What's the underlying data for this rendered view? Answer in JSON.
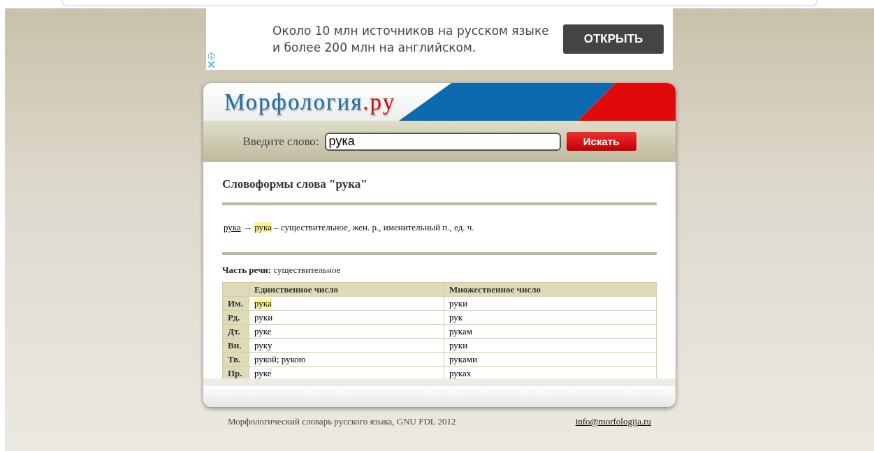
{
  "ad": {
    "text": "Около 10 млн источников на русском языке и более 200 млн на английском.",
    "button": "ОТКРЫТЬ"
  },
  "logo": {
    "name": "Морфология",
    "suffix": ".ру"
  },
  "search": {
    "label": "Введите слово:",
    "value": "рука",
    "button": "Искать"
  },
  "heading": "Словоформы слова \"рука\"",
  "wordform": {
    "source": "рука",
    "arrow": "→",
    "form": "рука",
    "highlighted": true,
    "description": "– существительное, жен. р., именительный п., ед. ч."
  },
  "part_of_speech": {
    "label": "Часть речи:",
    "value": "существительное"
  },
  "table": {
    "columns": [
      "Единственное число",
      "Множественное число"
    ],
    "rows": [
      {
        "case": "Им.",
        "singular": "рука",
        "plural": "руки",
        "highlighted": true
      },
      {
        "case": "Рд.",
        "singular": "руки",
        "plural": "рук",
        "highlighted": false
      },
      {
        "case": "Дт.",
        "singular": "руке",
        "plural": "рукам",
        "highlighted": false
      },
      {
        "case": "Вн.",
        "singular": "руку",
        "plural": "руки",
        "highlighted": false
      },
      {
        "case": "Тв.",
        "singular": "рукой; рукою",
        "plural": "руками",
        "highlighted": false
      },
      {
        "case": "Пр.",
        "singular": "руке",
        "plural": "руках",
        "highlighted": false
      }
    ]
  },
  "footer": {
    "text": "Морфологический словарь русского языка, GNU FDL 2012",
    "email": "info@morfologija.ru"
  }
}
